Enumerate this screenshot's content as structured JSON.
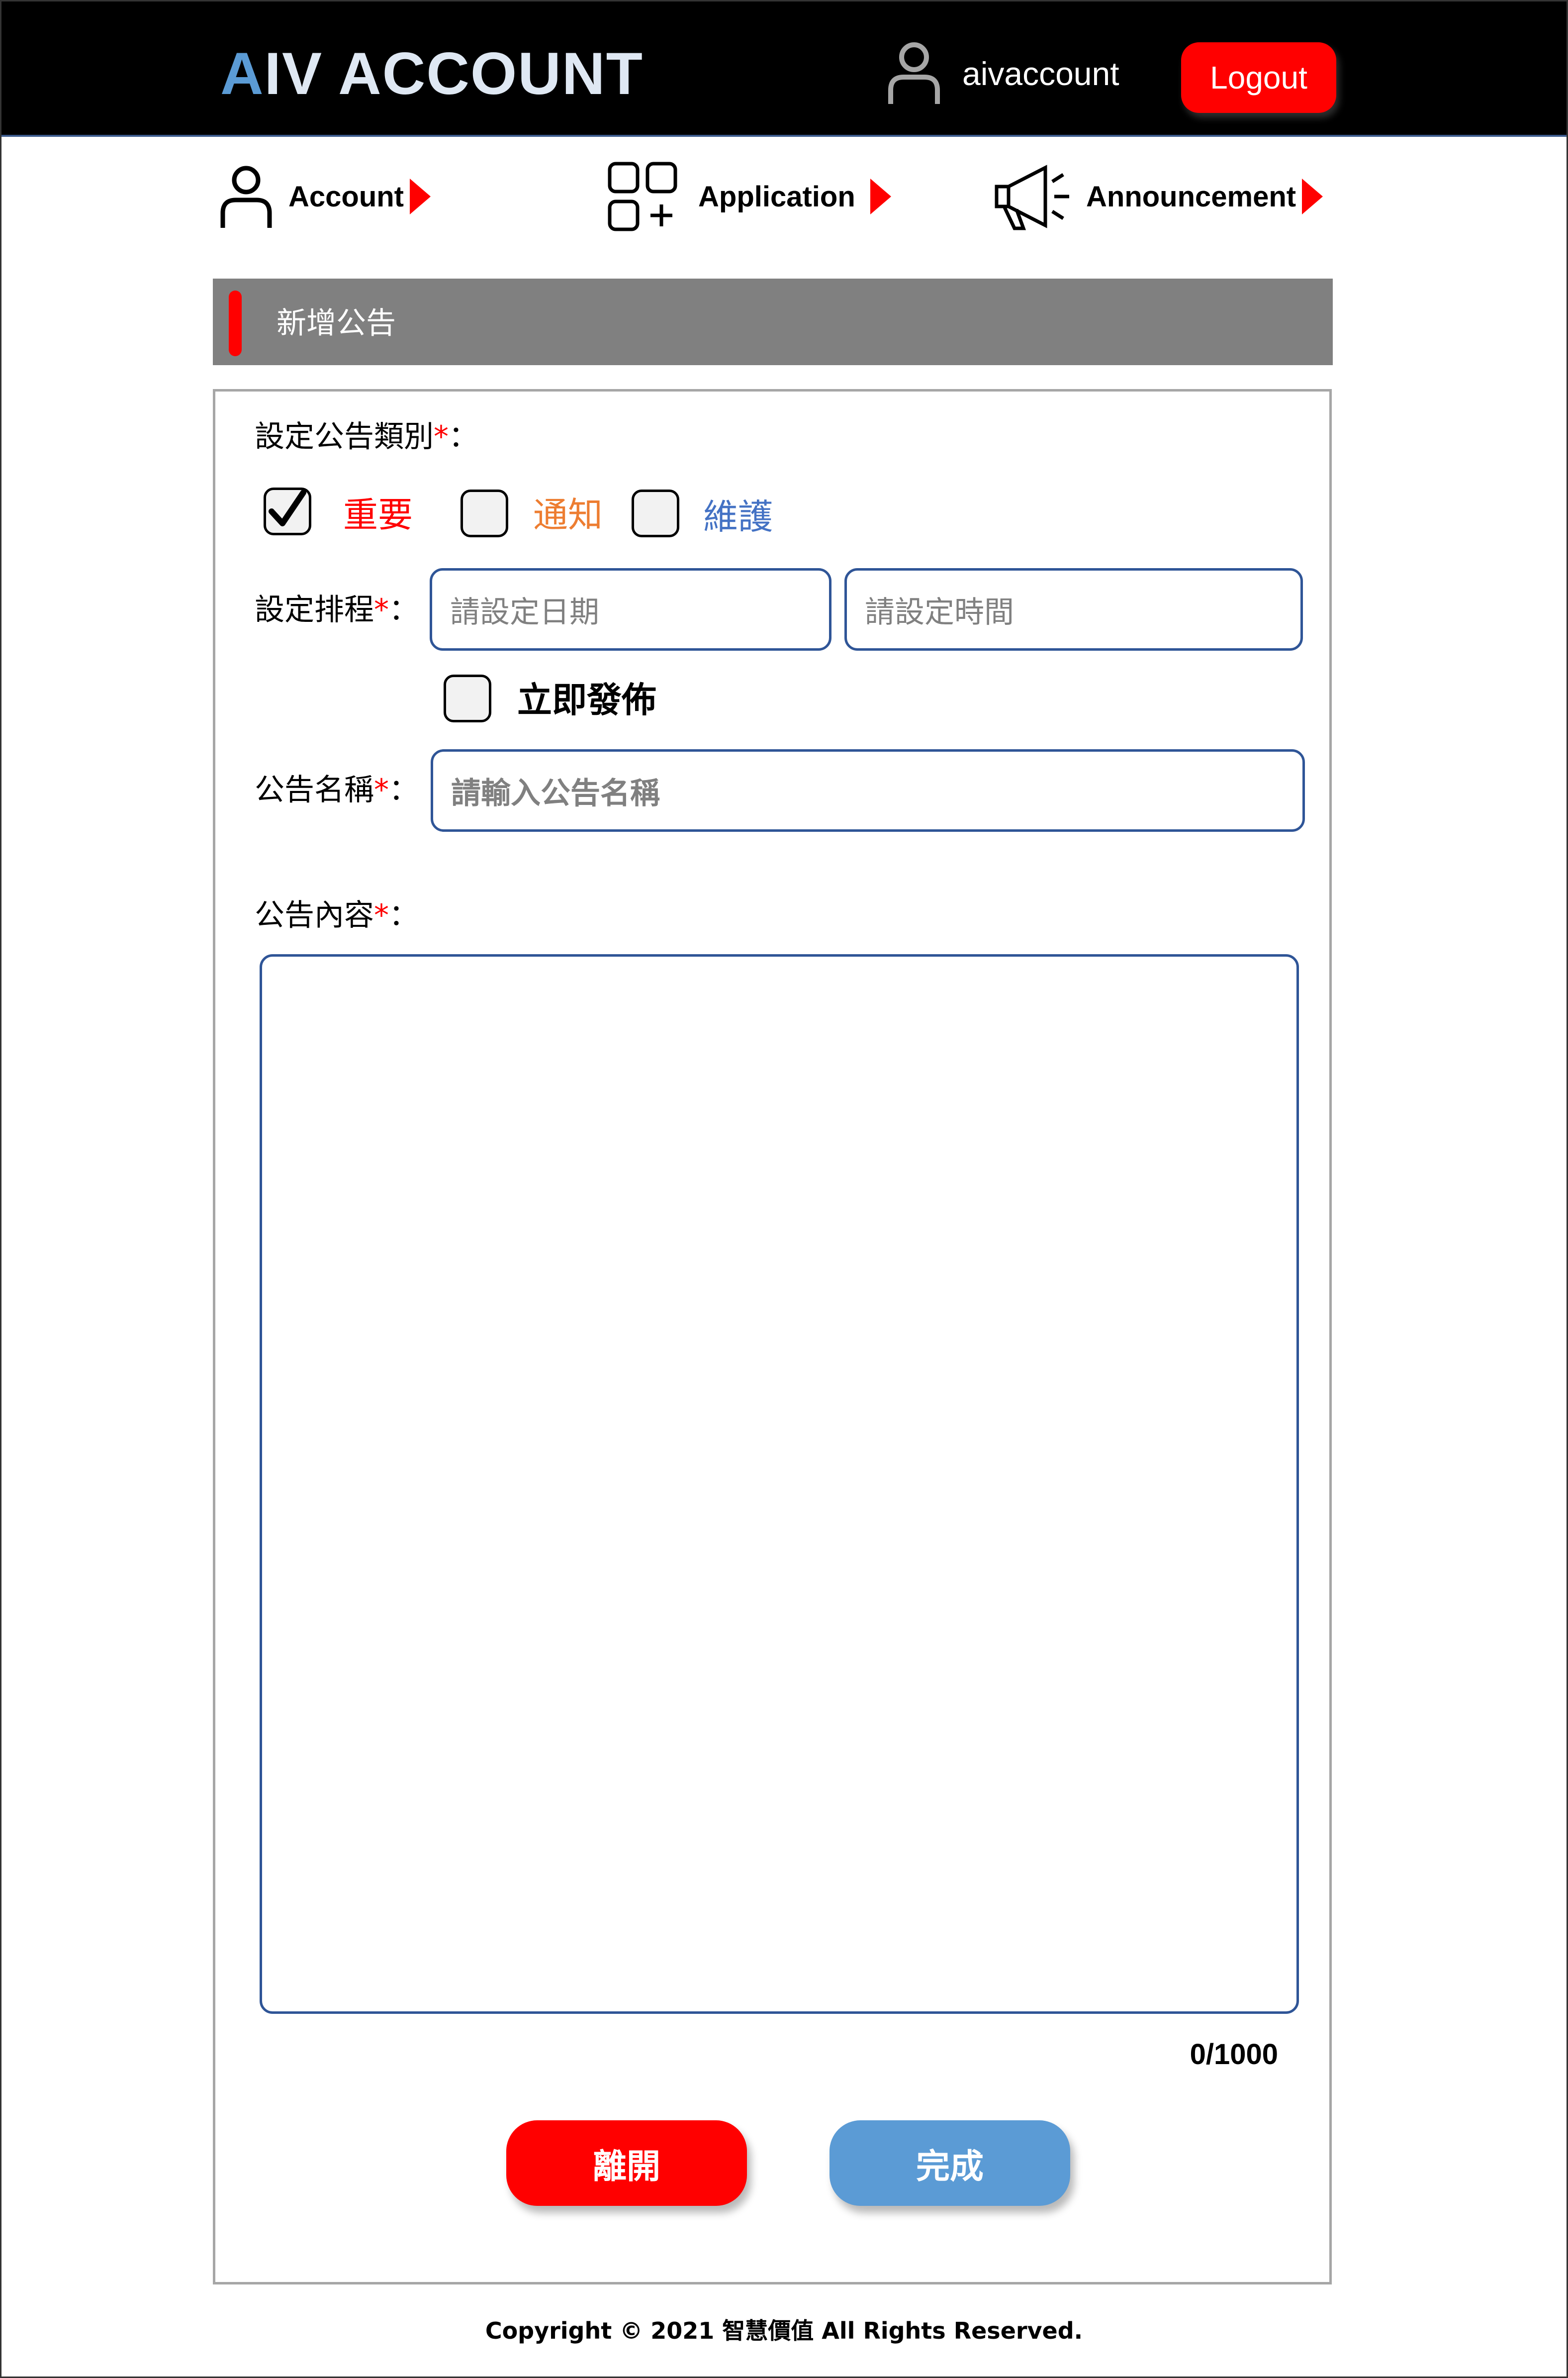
{
  "header": {
    "logo_letter": "A",
    "logo_rest": "IV ACCOUNT",
    "username": "aivaccount",
    "logout_label": "Logout"
  },
  "nav": {
    "account": "Account",
    "application": "Application",
    "announcement": "Announcement"
  },
  "section": {
    "title": "新增公告"
  },
  "form": {
    "category_label": "設定公告類別",
    "required_mark": "*",
    "colon": "：",
    "categories": [
      {
        "label": "重要",
        "checked": true,
        "color": "#ff0000"
      },
      {
        "label": "通知",
        "checked": false,
        "color": "#ed7d31"
      },
      {
        "label": "維護",
        "checked": false,
        "color": "#4472c4"
      }
    ],
    "schedule_label": "設定排程",
    "date_placeholder": "請設定日期",
    "time_placeholder": "請設定時間",
    "publish_now_label": "立即發佈",
    "publish_now_checked": false,
    "name_label": "公告名稱",
    "name_placeholder": "請輸入公告名稱",
    "content_label": "公告內容",
    "content_value": "",
    "char_count": "0/1000"
  },
  "buttons": {
    "leave": "離開",
    "leave_color": "#ff0000",
    "done": "完成",
    "done_color": "#5b9bd5"
  },
  "footer": {
    "copyright": "Copyright © 2021 智慧價值 All Rights Reserved."
  }
}
